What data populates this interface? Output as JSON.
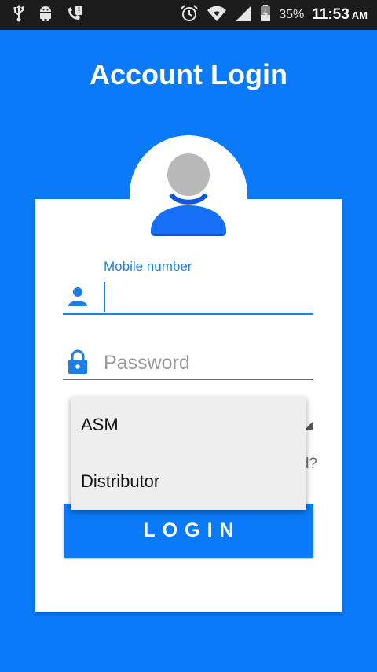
{
  "status_bar": {
    "battery": "35%",
    "time": "11:53",
    "ampm": "AM",
    "icons": [
      "usb-icon",
      "android-icon",
      "missed-call-icon",
      "alarm-icon",
      "wifi-icon",
      "signal-icon",
      "battery-icon"
    ]
  },
  "title": "Account Login",
  "avatar": {
    "icon": "user-avatar-icon"
  },
  "mobile": {
    "label": "Mobile number",
    "value": "",
    "icon": "person-icon"
  },
  "password": {
    "placeholder": "Password",
    "value": "",
    "icon": "lock-icon"
  },
  "user_type_dropdown": {
    "options": [
      "ASM",
      "Distributor"
    ],
    "arrow_icon": "dropdown-arrow-icon"
  },
  "forgot_password_partial": "d?",
  "login_button": "LOGIN",
  "colors": {
    "background": "#0a7af8",
    "accent": "#1e7ee6",
    "status_bar": "#1c1c1c",
    "card": "#ffffff",
    "dropdown": "#eeeeee"
  }
}
